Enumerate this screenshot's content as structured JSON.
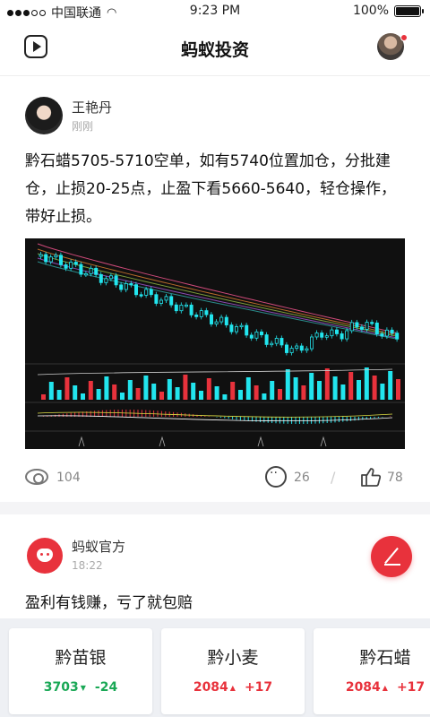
{
  "status": {
    "carrier": "中国联通",
    "time": "9:23 PM",
    "battery": "100%",
    "battery_level": 1.0
  },
  "header": {
    "title": "蚂蚁投资"
  },
  "post1": {
    "author": "王艳丹",
    "time": "刚刚",
    "text": "黔石蜡5705-5710空单，如有5740位置加仓，分批建仓，止损20-25点，止盈下看5660-5640，轻仓操作，带好止损。",
    "views": "104",
    "comments": "26",
    "likes": "78"
  },
  "post2": {
    "author": "蚂蚁官方",
    "time": "18:22",
    "text": "盈利有钱赚，亏了就包赔"
  },
  "tickers": [
    {
      "name": "黔苗银",
      "price": "3703",
      "change": "-24",
      "direction": "down",
      "arrow": "▼"
    },
    {
      "name": "黔小麦",
      "price": "2084",
      "change": "+17",
      "direction": "up",
      "arrow": "▲"
    },
    {
      "name": "黔石蜡",
      "price": "2084",
      "change": "+17",
      "direction": "up",
      "arrow": "▲"
    }
  ],
  "colors": {
    "accent": "#e8323c",
    "up": "#e8323c",
    "down": "#1aa856",
    "candle": "#22e5ee"
  },
  "icons": {
    "header_left": "play-icon",
    "views": "eye-icon",
    "comments": "comment-icon",
    "likes": "thumb-up-icon",
    "compose": "pen-icon"
  }
}
